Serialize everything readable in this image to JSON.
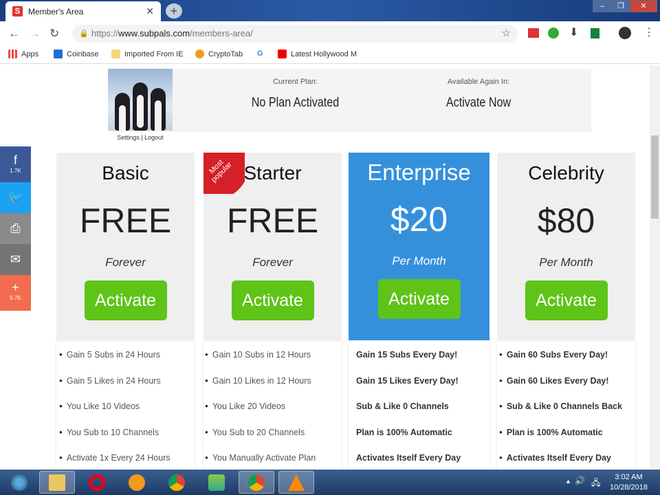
{
  "browser": {
    "tab_title": "Member's Area",
    "url_prefix": "https://",
    "url_domain": "www.subpals.com",
    "url_path": "/members-area/",
    "bookmarks": [
      {
        "label": "Apps",
        "color": "#e44"
      },
      {
        "label": "Coinbase",
        "color": "#1a6fd8"
      },
      {
        "label": "Imported From IE",
        "color": "#f6d77a"
      },
      {
        "label": "CryptoTab",
        "color": "#f39a1e"
      },
      {
        "label": "",
        "color": "#4285f4"
      },
      {
        "label": "Latest Hollywood M",
        "color": "#e00"
      }
    ]
  },
  "header": {
    "account_links": "Settings | Logout",
    "current_plan_label": "Current Plan:",
    "current_plan_value": "No Plan Activated",
    "available_label": "Available Again In:",
    "available_value": "Activate Now"
  },
  "share": {
    "facebook_count": "1.7K",
    "plus_count": "5.7K"
  },
  "ribbon": "Most popular",
  "plans": [
    {
      "name": "Basic",
      "price": "FREE",
      "period": "Forever",
      "button": "Activate",
      "features": [
        "Gain 5 Subs in 24 Hours",
        "Gain 5 Likes in 24 Hours",
        "You Like 10 Videos",
        "You Sub to 10 Channels",
        "Activate 1x Every 24 Hours"
      ]
    },
    {
      "name": "Starter",
      "price": "FREE",
      "period": "Forever",
      "button": "Activate",
      "features": [
        "Gain 10 Subs in 12 Hours",
        "Gain 10 Likes in 12 Hours",
        "You Like 20 Videos",
        "You Sub to 20 Channels",
        "You Manually Activate Plan"
      ]
    },
    {
      "name": "Enterprise",
      "price": "$20",
      "period": "Per Month",
      "button": "Activate",
      "features": [
        "Gain 15 Subs Every Day!",
        "Gain 15 Likes Every Day!",
        "Sub & Like 0 Channels",
        "Plan is 100% Automatic",
        "Activates Itself Every Day"
      ]
    },
    {
      "name": "Celebrity",
      "price": "$80",
      "period": "Per Month",
      "button": "Activate",
      "features": [
        "Gain 60 Subs Every Day!",
        "Gain 60 Likes Every Day!",
        "Sub & Like 0 Channels Back",
        "Plan is 100% Automatic",
        "Activates Itself Every Day"
      ]
    }
  ],
  "colors": {
    "accent_blue": "#3590dc",
    "button_green": "#5ec418",
    "ribbon_red": "#d61f26"
  },
  "taskbar": {
    "time": "3:02 AM",
    "date": "10/28/2018"
  }
}
